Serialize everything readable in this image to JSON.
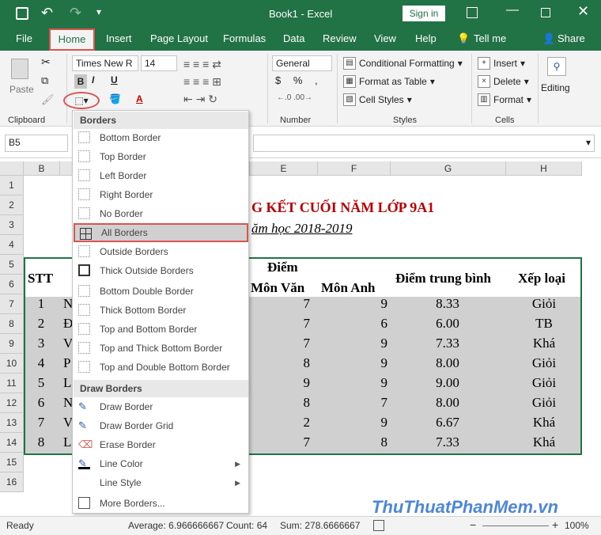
{
  "titlebar": {
    "title": "Book1  -  Excel",
    "signin": "Sign in"
  },
  "tabs": [
    "File",
    "Home",
    "Insert",
    "Page Layout",
    "Formulas",
    "Data",
    "Review",
    "View",
    "Help",
    "Tell me",
    "Share"
  ],
  "ribbon": {
    "paste": "Paste",
    "font_name": "Times New R",
    "font_size": "14",
    "number_format": "General",
    "conditional": "Conditional Formatting",
    "format_table": "Format as Table",
    "cell_styles": "Cell Styles",
    "insert": "Insert",
    "delete": "Delete",
    "format": "Format",
    "editing": "Editing",
    "groups": {
      "clipboard": "Clipboard",
      "number": "Number",
      "styles": "Styles",
      "cells": "Cells"
    }
  },
  "namebox": "B5",
  "columns": [
    "B",
    "E",
    "F",
    "G",
    "H"
  ],
  "rows": [
    "1",
    "2",
    "3",
    "4",
    "5",
    "6",
    "7",
    "8",
    "9",
    "10",
    "11",
    "12",
    "13",
    "14",
    "15",
    "16"
  ],
  "sheet": {
    "title": "G KẾT CUỐI NĂM LỚP 9A1",
    "subtitle": "ăm học 2018-2019",
    "h_stt": "STT",
    "h_diem": "Điểm",
    "h_van": "Môn Văn",
    "h_anh": "Môn Anh",
    "h_tb": "Điểm trung bình",
    "h_xl": "Xếp loại",
    "data": [
      {
        "stt": "1",
        "n": "N",
        "van": "7",
        "anh": "9",
        "tb": "8.33",
        "xl": "Giỏi"
      },
      {
        "stt": "2",
        "n": "Đ",
        "van": "7",
        "anh": "6",
        "tb": "6.00",
        "xl": "TB"
      },
      {
        "stt": "3",
        "n": "V",
        "van": "7",
        "anh": "9",
        "tb": "7.33",
        "xl": "Khá"
      },
      {
        "stt": "4",
        "n": "P",
        "van": "8",
        "anh": "9",
        "tb": "8.00",
        "xl": "Giỏi"
      },
      {
        "stt": "5",
        "n": "L",
        "van": "9",
        "anh": "9",
        "tb": "9.00",
        "xl": "Giỏi"
      },
      {
        "stt": "6",
        "n": "N",
        "van": "8",
        "anh": "7",
        "tb": "8.00",
        "xl": "Giỏi"
      },
      {
        "stt": "7",
        "n": "V",
        "van": "2",
        "anh": "9",
        "tb": "6.67",
        "xl": "Khá"
      },
      {
        "stt": "8",
        "n": "L",
        "van": "7",
        "anh": "8",
        "tb": "7.33",
        "xl": "Khá"
      }
    ]
  },
  "menu": {
    "borders_header": "Borders",
    "items": [
      "Bottom Border",
      "Top Border",
      "Left Border",
      "Right Border",
      "No Border",
      "All Borders",
      "Outside Borders",
      "Thick Outside Borders",
      "Bottom Double Border",
      "Thick Bottom Border",
      "Top and Bottom Border",
      "Top and Thick Bottom Border",
      "Top and Double Bottom Border"
    ],
    "draw_header": "Draw Borders",
    "draw_items": [
      "Draw Border",
      "Draw Border Grid",
      "Erase Border",
      "Line Color",
      "Line Style",
      "More Borders..."
    ]
  },
  "status": {
    "ready": "Ready",
    "average": "Average: 6.966666667",
    "count": "Count: 64",
    "sum": "Sum: 278.6666667",
    "zoom": "100%"
  },
  "watermark": "ThuThuatPhanMem.vn",
  "colors": {
    "excel_green": "#217346",
    "highlight": "#d9534f",
    "title_red": "#c00000"
  }
}
